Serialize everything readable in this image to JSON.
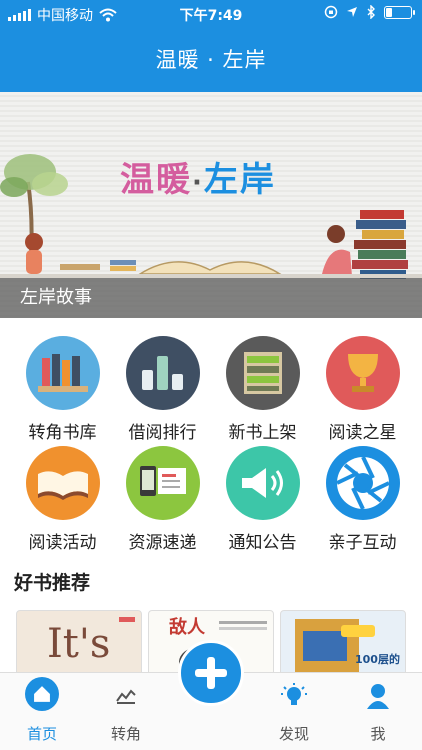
{
  "status_bar": {
    "carrier": "中国移动",
    "time": "下午7:49"
  },
  "nav": {
    "title": "温暖 · 左岸"
  },
  "banner": {
    "title_part1": "温暖",
    "title_separator": "·",
    "title_part2": "左岸",
    "caption": "左岸故事"
  },
  "grid": {
    "items": [
      {
        "label": "转角书库",
        "icon": "bookshelf-icon",
        "color": "#5aaee0"
      },
      {
        "label": "借阅排行",
        "icon": "bar-chart-icon",
        "color": "#3f4f63"
      },
      {
        "label": "新书上架",
        "icon": "books-rack-icon",
        "color": "#5a5a5a"
      },
      {
        "label": "阅读之星",
        "icon": "trophy-icon",
        "color": "#e05a5a"
      },
      {
        "label": "阅读活动",
        "icon": "open-book-icon",
        "color": "#f0912e"
      },
      {
        "label": "资源速递",
        "icon": "phone-document-icon",
        "color": "#8cc63f"
      },
      {
        "label": "通知公告",
        "icon": "megaphone-icon",
        "color": "#3dc6a8"
      },
      {
        "label": "亲子互动",
        "icon": "aperture-icon",
        "color": "#1c8fe0"
      }
    ]
  },
  "recommend": {
    "title": "好书推荐",
    "books": [
      {
        "cover_text": "It's"
      },
      {
        "cover_text": "敌人"
      },
      {
        "cover_text": "100层的"
      }
    ]
  },
  "tabbar": {
    "items": [
      {
        "label": "首页",
        "icon": "home-icon",
        "active": true
      },
      {
        "label": "转角",
        "icon": "trend-icon",
        "active": false
      },
      {
        "label": "发现",
        "icon": "lightbulb-icon",
        "active": false
      },
      {
        "label": "我",
        "icon": "user-icon",
        "active": false
      }
    ],
    "center_button_icon": "plus-icon"
  },
  "colors": {
    "primary": "#1c8fe0",
    "banner_pink": "#d45d9e"
  }
}
